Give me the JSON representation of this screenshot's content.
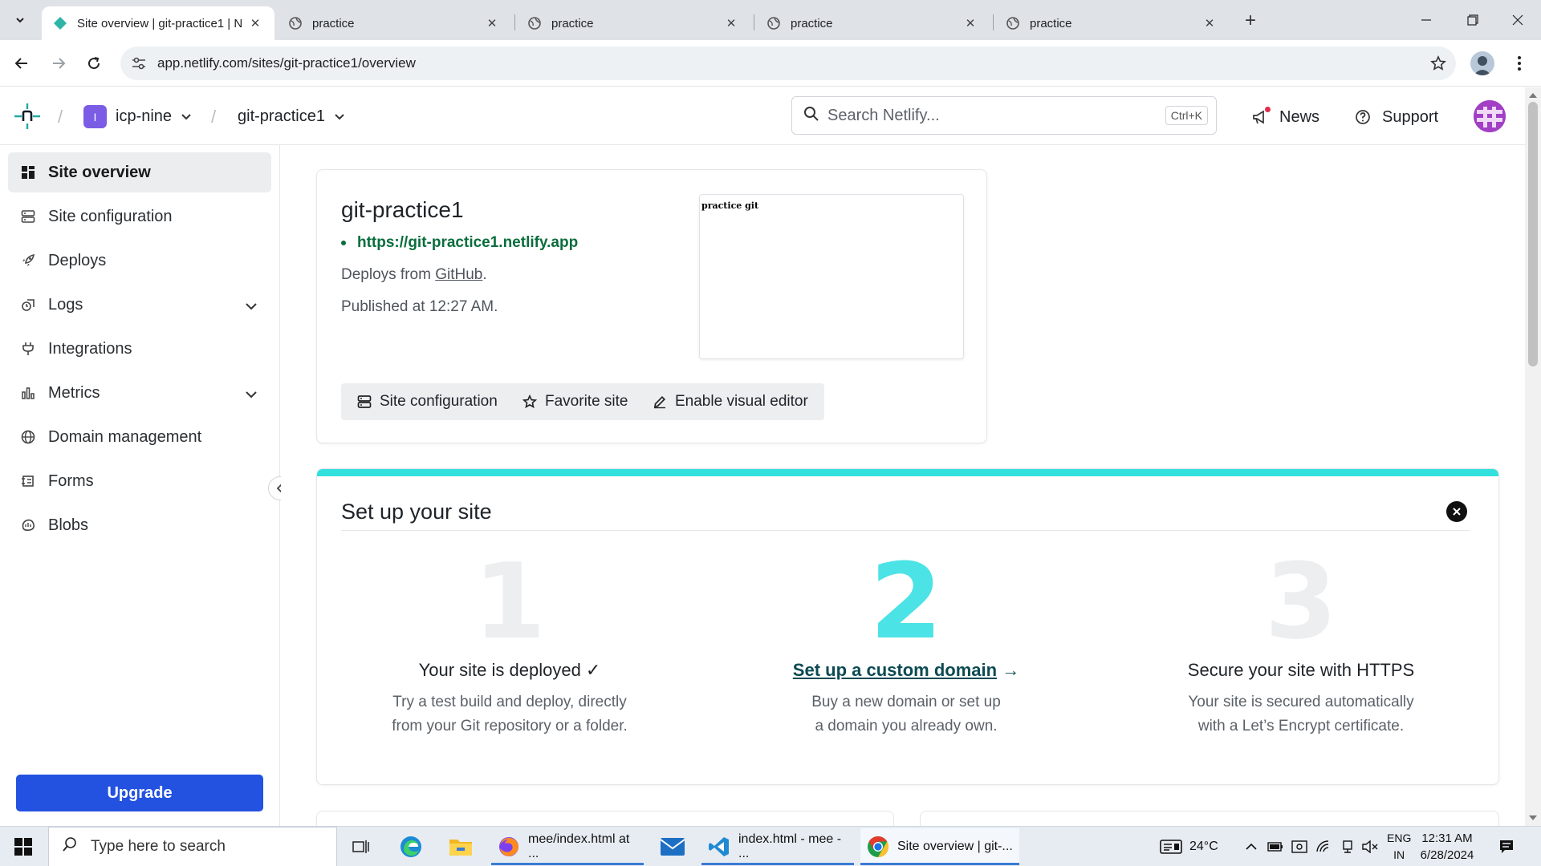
{
  "browser": {
    "tabs": [
      {
        "title": "Site overview | git-practice1 | N",
        "active": true
      },
      {
        "title": "practice",
        "active": false
      },
      {
        "title": "practice",
        "active": false
      },
      {
        "title": "practice",
        "active": false
      },
      {
        "title": "practice",
        "active": false
      }
    ],
    "url": "app.netlify.com/sites/git-practice1/overview"
  },
  "header": {
    "team_initial": "I",
    "team_name": "icp-nine",
    "site_name": "git-practice1",
    "search_placeholder": "Search Netlify...",
    "search_shortcut": "Ctrl+K",
    "news_label": "News",
    "support_label": "Support"
  },
  "sidebar": {
    "items": [
      {
        "label": "Site overview",
        "icon": "grid-icon",
        "active": true
      },
      {
        "label": "Site configuration",
        "icon": "server-icon"
      },
      {
        "label": "Deploys",
        "icon": "rocket-icon"
      },
      {
        "label": "Logs",
        "icon": "logs-icon",
        "expandable": true
      },
      {
        "label": "Integrations",
        "icon": "plug-icon"
      },
      {
        "label": "Metrics",
        "icon": "bar-chart-icon",
        "expandable": true
      },
      {
        "label": "Domain management",
        "icon": "globe-icon"
      },
      {
        "label": "Forms",
        "icon": "forms-icon"
      },
      {
        "label": "Blobs",
        "icon": "blobs-icon"
      }
    ],
    "upgrade_label": "Upgrade"
  },
  "site_card": {
    "name": "git-practice1",
    "url": "https://git-practice1.netlify.app",
    "deploys_prefix": "Deploys from ",
    "deploys_source": "GitHub",
    "deploys_suffix": ".",
    "published": "Published at 12:27 AM.",
    "preview_text": "practice git",
    "buttons": {
      "site_config": "Site configuration",
      "favorite": "Favorite site",
      "visual_editor": "Enable visual editor"
    }
  },
  "setup": {
    "title": "Set up your site",
    "steps": [
      {
        "number": "1",
        "title": "Your site is deployed ✓",
        "desc_line1": "Try a test build and deploy, directly",
        "desc_line2": "from your Git repository or a folder."
      },
      {
        "number": "2",
        "title": "Set up a custom domain",
        "arrow": "→",
        "desc_line1": "Buy a new domain or set up",
        "desc_line2": "a domain you already own."
      },
      {
        "number": "3",
        "title": "Secure your site with HTTPS",
        "desc_line1": "Your site is secured automatically",
        "desc_line2": "with a Let’s Encrypt certificate."
      }
    ]
  },
  "taskbar": {
    "search_placeholder": "Type here to search",
    "apps": [
      {
        "label": "mee/index.html at ...",
        "icon": "firefox-icon"
      },
      {
        "label": "index.html - mee - ...",
        "icon": "vscode-icon"
      },
      {
        "label": "Site overview | git-...",
        "icon": "chrome-icon",
        "active": true
      }
    ],
    "weather": "24°C",
    "lang_line1": "ENG",
    "lang_line2": "IN",
    "time": "12:31 AM",
    "date": "6/28/2024"
  },
  "colors": {
    "accent_teal": "#32e0dd",
    "upgrade_blue": "#2352e0",
    "url_green": "#0a6d3c",
    "team_purple": "#7b5ce5"
  }
}
